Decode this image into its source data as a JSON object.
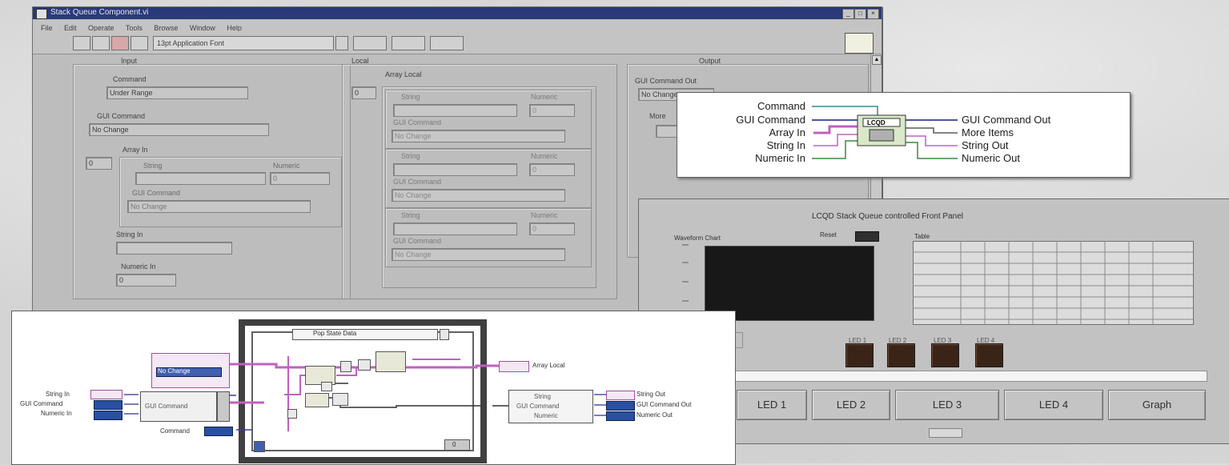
{
  "window": {
    "title": "Stack Queue Component.vi",
    "menu": [
      "File",
      "Edit",
      "Operate",
      "Tools",
      "Browse",
      "Window",
      "Help"
    ],
    "font_select": "13pt Application Font",
    "controls": [
      "min",
      "max",
      "close"
    ]
  },
  "front_panel": {
    "input": {
      "heading": "Input",
      "command_label": "Command",
      "command_value": "Under Range",
      "gui_command_label": "GUI Command",
      "gui_command_value": "No Change",
      "array_in_label": "Array In",
      "array_index": "0",
      "string_label": "String",
      "numeric_label": "Numeric",
      "numeric_value": "0",
      "inner_gui_label": "GUI Command",
      "inner_gui_value": "No Change",
      "string_in_label": "String In",
      "numeric_in_label": "Numeric In",
      "numeric_in_value": "0"
    },
    "local": {
      "heading": "Local",
      "array_label": "Array Local",
      "array_index": "0",
      "clusters": [
        {
          "string_label": "String",
          "numeric_label": "Numeric",
          "numeric_value": "0",
          "gui_label": "GUI Command",
          "gui_value": "No Change"
        },
        {
          "string_label": "String",
          "numeric_label": "Numeric",
          "numeric_value": "0",
          "gui_label": "GUI Command",
          "gui_value": "No Change"
        },
        {
          "string_label": "String",
          "numeric_label": "Numeric",
          "numeric_value": "0",
          "gui_label": "GUI Command",
          "gui_value": "No Change"
        }
      ]
    },
    "output": {
      "heading": "Output",
      "gui_command_out_label": "GUI Command Out",
      "gui_command_out_value": "No Change",
      "more_items_label": "More"
    }
  },
  "icon_inset": {
    "inputs": [
      "Command",
      "GUI Command",
      "Array In",
      "String In",
      "Numeric In"
    ],
    "outputs": [
      "GUI Command Out",
      "More Items",
      "String Out",
      "Numeric Out"
    ],
    "icon_text": "LCQD"
  },
  "controlled_panel": {
    "title": "LCQD Stack Queue controlled Front Panel",
    "waveform_label": "Waveform Chart",
    "reset_label": "Reset",
    "table_label": "Table",
    "led_labels": [
      "LED 1",
      "LED 2",
      "LED 3",
      "LED 4"
    ],
    "buttons": [
      "LED 1",
      "LED 2",
      "LED 3",
      "LED 4",
      "Graph"
    ]
  },
  "block_diagram": {
    "case_label": "Pop State Data",
    "left_inputs": [
      "String In",
      "GUI Command",
      "Numeric In"
    ],
    "command_label": "Command",
    "bundle_top": "No Change",
    "unbundle_items": [
      "String",
      "GUI Command",
      "Numeric"
    ],
    "array_local_label": "Array Local",
    "right_outputs": [
      "String Out",
      "GUI Command Out",
      "Numeric Out"
    ],
    "case_index": "0"
  },
  "colors": {
    "titlebar": "#283878",
    "panel": "#bdbdbd",
    "wire_pink": "#c060c0",
    "wire_blue": "#2850a0",
    "led_off": "#3a2418"
  }
}
